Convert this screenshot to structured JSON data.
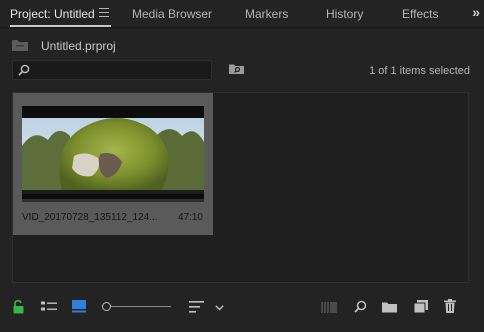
{
  "tabs": [
    {
      "label": "Project: Untitled",
      "active": true
    },
    {
      "label": "Media Browser",
      "active": false
    },
    {
      "label": "Markers",
      "active": false
    },
    {
      "label": "History",
      "active": false
    },
    {
      "label": "Effects",
      "active": false
    }
  ],
  "overflow_label": "»",
  "project": {
    "file_name": "Untitled.prproj"
  },
  "search": {
    "value": "",
    "placeholder": ""
  },
  "status": "1 of 1 items selected",
  "clip": {
    "name": "VID_20170728_135112_124...",
    "duration": "47:10",
    "progress": 0.0
  },
  "colors": {
    "accent": "#2f7fdc",
    "lock_green": "#39b54a",
    "selection": "#5a5a5a"
  },
  "icons": {
    "lock": "unlock-icon",
    "list_view": "list-view-icon",
    "icon_view": "icon-view-icon",
    "sort": "sort-icon",
    "automate": "automate-to-sequence-icon",
    "find": "find-icon",
    "new_bin": "new-bin-icon",
    "new_item": "new-item-icon",
    "clear": "trash-icon"
  }
}
